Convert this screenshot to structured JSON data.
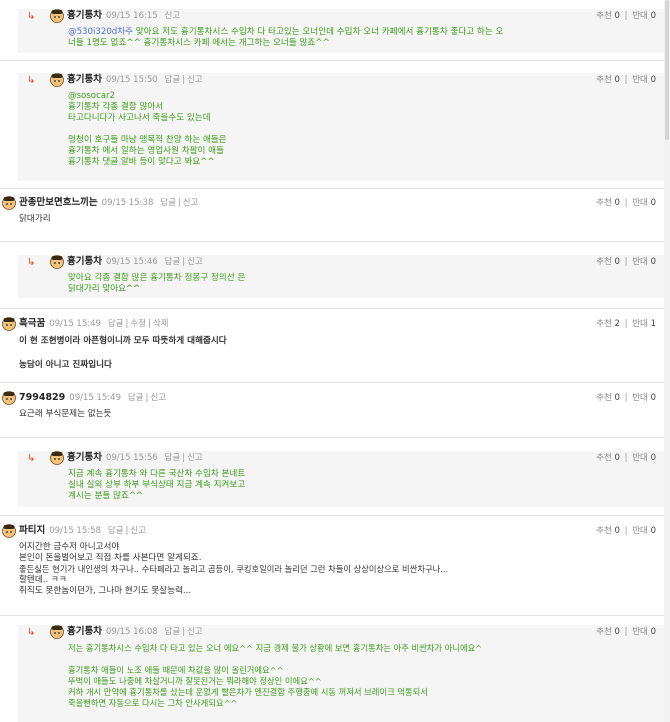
{
  "labels": {
    "recommend": "추천",
    "oppose": "반대",
    "reply": "답글",
    "report": "신고",
    "edit": "수정",
    "delete": "삭제"
  },
  "comments": [
    {
      "nick": "흉기통차",
      "date": "09/15 16:15",
      "recommend": "0",
      "oppose": "0",
      "actions": [
        "report"
      ],
      "mention": "@530i320d차주",
      "line1_rest": " 맞아요 저도 흉기통차시스 수입차 다 타고있는 오너인데 수입차 오너 카페에서 흉기통차 좋다고 하는 오",
      "lines": [
        "너들 1명도 없죠^^ 흉기통차시스 카페 에서는 개그하는 오너들 많죠^^"
      ]
    },
    {
      "nick": "흉기통차",
      "date": "09/15 15:50",
      "recommend": "0",
      "oppose": "0",
      "actions": [
        "reply",
        "report"
      ],
      "lines": [
        "@sosocar2",
        "흉기통차 각종 결함 많아서",
        "타고다니다가 사고나서 죽을수도 있는데",
        "",
        "멍청이 호구들 마냥 맹목적 찬양 하는 애들은",
        "흉기통차 에서 일하는 영업사원 차팔이 애들",
        "흉기통차 댓글 알바 등이 맞다고 봐요^^"
      ]
    },
    {
      "nick": "관종만보면흐느끼는",
      "date": "09/15 15:38",
      "recommend": "0",
      "oppose": "0",
      "actions": [
        "reply",
        "report"
      ],
      "lines": [
        "닭대가리"
      ]
    },
    {
      "nick": "흉기통차",
      "date": "09/15 15:46",
      "recommend": "0",
      "oppose": "0",
      "actions": [
        "reply",
        "report"
      ],
      "lines": [
        "맞아요 각종 결함 많은 흉기통차 정몽구 정의선 은",
        "닭대가리 맞아요^^"
      ]
    },
    {
      "nick": "흑극꿈",
      "date": "09/15 15:49",
      "recommend": "2",
      "oppose": "1",
      "actions": [
        "reply",
        "edit",
        "delete"
      ],
      "lines": [
        "이 현 조현병이라 아픈형이니까 모두 따뜻하게 대해줍시다",
        "",
        "농담이 아니고 진짜입니다"
      ]
    },
    {
      "nick": "7994829",
      "date": "09/15 15:49",
      "recommend": "0",
      "oppose": "0",
      "actions": [
        "reply",
        "report"
      ],
      "lines": [
        "요근래 부식문제는 없는듯"
      ]
    },
    {
      "nick": "흉기통차",
      "date": "09/15 15:56",
      "recommend": "0",
      "oppose": "0",
      "actions": [
        "reply",
        "report"
      ],
      "lines": [
        "지금 계속 흉기통차 와 다른 국산차 수입차 본네트",
        "실내 실외 상부 하부 부식상태 지금 계속 지켜보고",
        "계시는 분들 많죠^^"
      ]
    },
    {
      "nick": "파티지",
      "date": "09/15 15:58",
      "recommend": "0",
      "oppose": "0",
      "actions": [
        "reply",
        "report"
      ],
      "lines": [
        "어지간한 금수저 아니고서야",
        "본인이 돈을벌어보고 직접 차를 사본다면 알게되죠.",
        "좋든싫든 현기가 내인생의 차구나.. 수타페라고 놀리고 곱등이, 쿠킹호일이라 놀리던 그런 차들이 상상이상으로 비싼차구나...",
        "할텐데.. ㅋㅋ",
        "취직도 못한놈이던가, 그나마 현기도 못살능력..."
      ]
    },
    {
      "nick": "흉기통차",
      "date": "09/15 16:08",
      "recommend": "0",
      "oppose": "0",
      "actions": [
        "reply",
        "report"
      ],
      "lines": [
        "저는 흉기통차시스 수입차 다 타고 있는 오너 에요^^ 지금 경제 불가 상황에 보면 흉기통차는 아주 비싼차가 아니에요^",
        "",
        "흉기통차 애들이 노조 애들 때문에 차값을 많이 올린거에요^^",
        "뚜벅이 애들도 나중에 차살거니까 잘못된거는 뭐라해야 정상인 이에요^^",
        "커하 개시 만약에 흉기통차를 샀는데 운없게 빨은차가 엔진결함 주행중에 시동 꺼져서 브레이크 먹통되서",
        "죽을뻔하면 자동으로 다시는 그차 안사게되요^^"
      ]
    }
  ]
}
